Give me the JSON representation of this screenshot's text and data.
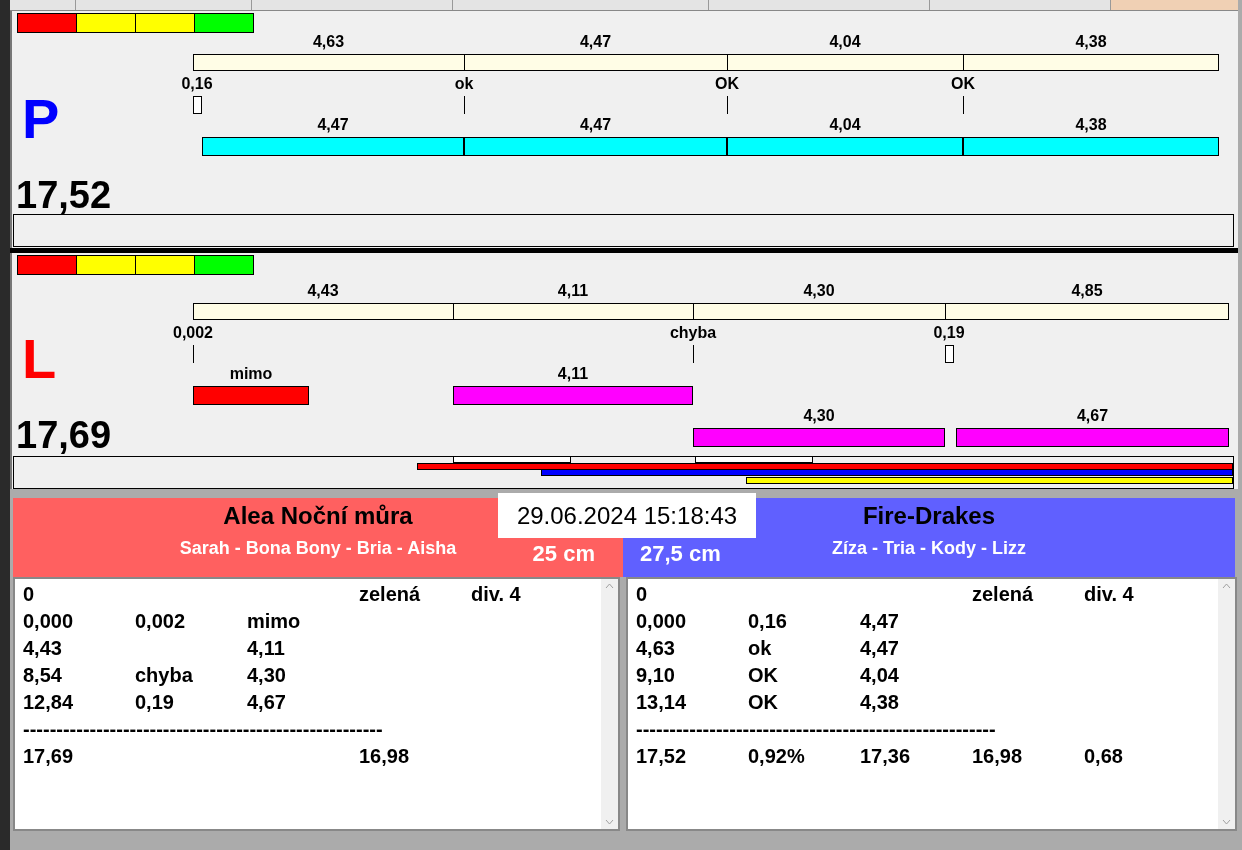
{
  "lanes": [
    {
      "letter": "P",
      "color": "#0000ff",
      "segments": [
        "4,63",
        "4,47",
        "4,04",
        "4,38"
      ],
      "checkpoints": [
        {
          "label": "0,16",
          "kind": "box"
        },
        {
          "label": "ok",
          "kind": "tick"
        },
        {
          "label": "OK",
          "kind": "tick"
        },
        {
          "label": "OK",
          "kind": "tick"
        }
      ],
      "run_rows": [
        [
          {
            "label": "4,47",
            "color": "#00ffff"
          },
          {
            "label": "4,47",
            "color": "#00ffff"
          },
          {
            "label": "4,04",
            "color": "#00ffff"
          },
          {
            "label": "4,38",
            "color": "#00ffff"
          }
        ]
      ],
      "total": "17,52"
    },
    {
      "letter": "L",
      "color": "#ff0000",
      "segments": [
        "4,43",
        "4,11",
        "4,30",
        "4,85"
      ],
      "checkpoints": [
        {
          "label": "0,002",
          "kind": "tick"
        },
        {
          "label": "chyba",
          "kind": "tick"
        },
        {
          "label": "0,19",
          "kind": "box"
        }
      ],
      "run_rows": [
        [
          {
            "label": "mimo",
            "color": "#ff0000"
          },
          {
            "label": "4,11",
            "color": "#ff00ff"
          }
        ],
        [
          {
            "label": "4,30",
            "color": "#ff00ff"
          },
          {
            "label": "4,67",
            "color": "#ff00ff"
          }
        ]
      ],
      "total": "17,69",
      "track_lines": [
        {
          "color": "#ff0000"
        },
        {
          "color": "#0000ff"
        },
        {
          "color": "#ffff00"
        }
      ]
    }
  ],
  "datetime": "29.06.2024 15:18:43",
  "teams": [
    {
      "name": "Alea Noční můra",
      "dogs": "Sarah - Bona Bony - Bria - Aisha",
      "height": "25 cm",
      "color": "#ff6060",
      "rows": [
        [
          "0",
          null,
          null,
          "zelená",
          "div. 4"
        ],
        [
          "0,000",
          "0,002",
          "mimo"
        ],
        [
          "4,43",
          null,
          "4,11"
        ],
        [
          "8,54",
          "chyba",
          "4,30"
        ],
        [
          "12,84",
          "0,19",
          "4,67"
        ],
        [
          "------------------------------------------------------"
        ],
        [
          "17,69",
          null,
          null,
          "16,98"
        ]
      ]
    },
    {
      "name": "Fire-Drakes",
      "dogs": "Zíza - Tria - Kody - Lizz",
      "height": "27,5 cm",
      "color": "#6060ff",
      "rows": [
        [
          "0",
          null,
          null,
          "zelená",
          "div. 4"
        ],
        [
          "0,000",
          "0,16",
          "4,47"
        ],
        [
          "4,63",
          "ok",
          "4,47"
        ],
        [
          "9,10",
          "OK",
          "4,04"
        ],
        [
          "13,14",
          "OK",
          "4,38"
        ],
        [
          "------------------------------------------------------"
        ],
        [
          "17,52",
          "0,92%",
          "17,36",
          "16,98",
          "0,68"
        ]
      ]
    }
  ]
}
